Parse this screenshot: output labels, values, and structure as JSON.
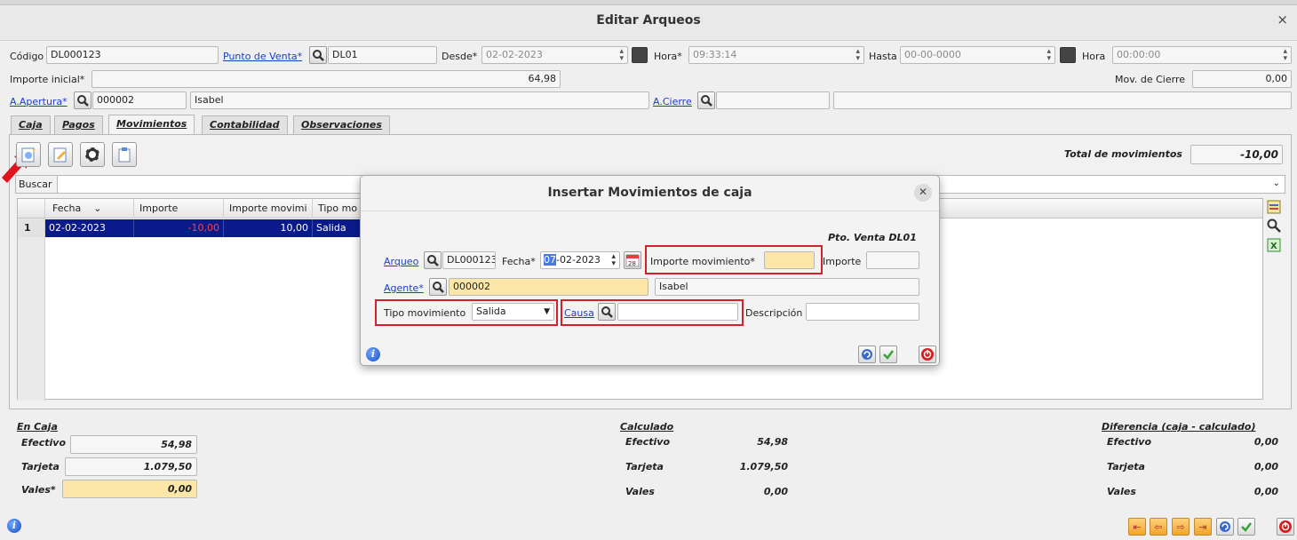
{
  "window": {
    "title": "Editar Arqueos",
    "close": "×"
  },
  "header": {
    "codigo_label": "Código",
    "codigo_value": "DL000123",
    "punto_venta_label": "Punto de Venta*",
    "punto_venta_value": "DL01",
    "desde_label": "Desde*",
    "desde_value": "02-02-2023",
    "hora1_label": "Hora*",
    "hora1_value": "09:33:14",
    "hasta_label": "Hasta",
    "hasta_value": "00-00-0000",
    "hora2_label": "Hora",
    "hora2_value": "00:00:00",
    "importe_inicial_label": "Importe inicial*",
    "importe_inicial_value": "64,98",
    "mov_cierre_label": "Mov. de Cierre",
    "mov_cierre_value": "0,00",
    "apertura_label": "A.Apertura*",
    "apertura_code": "000002",
    "apertura_name": "Isabel",
    "cierre_label": "A.Cierre"
  },
  "tabs": [
    {
      "label": "Caja"
    },
    {
      "label": "Pagos"
    },
    {
      "label": "Movimientos"
    },
    {
      "label": "Contabilidad"
    },
    {
      "label": "Observaciones"
    }
  ],
  "movimientos": {
    "total_label": "Total de movimientos",
    "total_value": "-10,00",
    "buscar_label": "Buscar",
    "columns": [
      "Fecha",
      "Importe",
      "Importe movimi",
      "Tipo mo"
    ],
    "rows": [
      {
        "num": "1",
        "fecha": "02-02-2023",
        "importe": "-10,00",
        "importe_mov": "10,00",
        "tipo": "Salida"
      }
    ]
  },
  "summary": {
    "en_caja_title": "En Caja",
    "calculado_title": "Calculado",
    "diferencia_title": "Diferencia (caja - calculado)",
    "efectivo_label": "Efectivo",
    "tarjeta_label": "Tarjeta",
    "vales_label": "Vales",
    "vales_req_label": "Vales*",
    "caja": {
      "efectivo": "54,98",
      "tarjeta": "1.079,50",
      "vales": "0,00"
    },
    "calculado": {
      "efectivo": "54,98",
      "tarjeta": "1.079,50",
      "vales": "0,00"
    },
    "diferencia": {
      "efectivo": "0,00",
      "tarjeta": "0,00",
      "vales": "0,00"
    }
  },
  "modal": {
    "title": "Insertar Movimientos de caja",
    "pto_venta": "Pto. Venta DL01",
    "arqueo_label": "Arqueo",
    "arqueo_value": "DL000123",
    "fecha_label": "Fecha*",
    "fecha_day": "07",
    "fecha_rest": "-02-2023",
    "calendar_day": "28",
    "importe_mov_label": "Importe movimiento*",
    "importe_mov_value": "",
    "importe_label": "Importe",
    "importe_value": "",
    "agente_label": "Agente*",
    "agente_code": "000002",
    "agente_name": "Isabel",
    "tipo_label": "Tipo movimiento",
    "tipo_value": "Salida",
    "causa_label": "Causa",
    "causa_value": "",
    "descripcion_label": "Descripción",
    "descripcion_value": ""
  },
  "colors": {
    "accent_red": "#d4202a",
    "selected_row": "#0a1a8a",
    "link": "#1a3ec7",
    "required_field": "#fde7a8"
  }
}
